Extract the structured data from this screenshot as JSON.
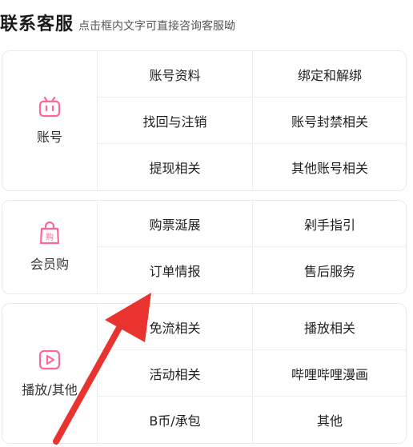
{
  "header": {
    "title": "联系客服",
    "subtitle": "点击框内文字可直接咨询客服呦"
  },
  "accent": "#ff6699",
  "arrow_color": "#e8332e",
  "sections": [
    {
      "label": "账号",
      "icon": "tv-icon",
      "rows": [
        [
          "账号资料",
          "绑定和解绑"
        ],
        [
          "找回与注销",
          "账号封禁相关"
        ],
        [
          "提现相关",
          "其他账号相关"
        ]
      ]
    },
    {
      "label": "会员购",
      "icon": "shopping-bag-icon",
      "rows": [
        [
          "购票涎展",
          "剁手指引"
        ],
        [
          "订单情报",
          "售后服务"
        ]
      ]
    },
    {
      "label": "播放/其他",
      "icon": "play-icon",
      "rows": [
        [
          "免流相关",
          "播放相关"
        ],
        [
          "活动相关",
          "哔哩哔哩漫画"
        ],
        [
          "B币/承包",
          "其他"
        ]
      ]
    }
  ]
}
